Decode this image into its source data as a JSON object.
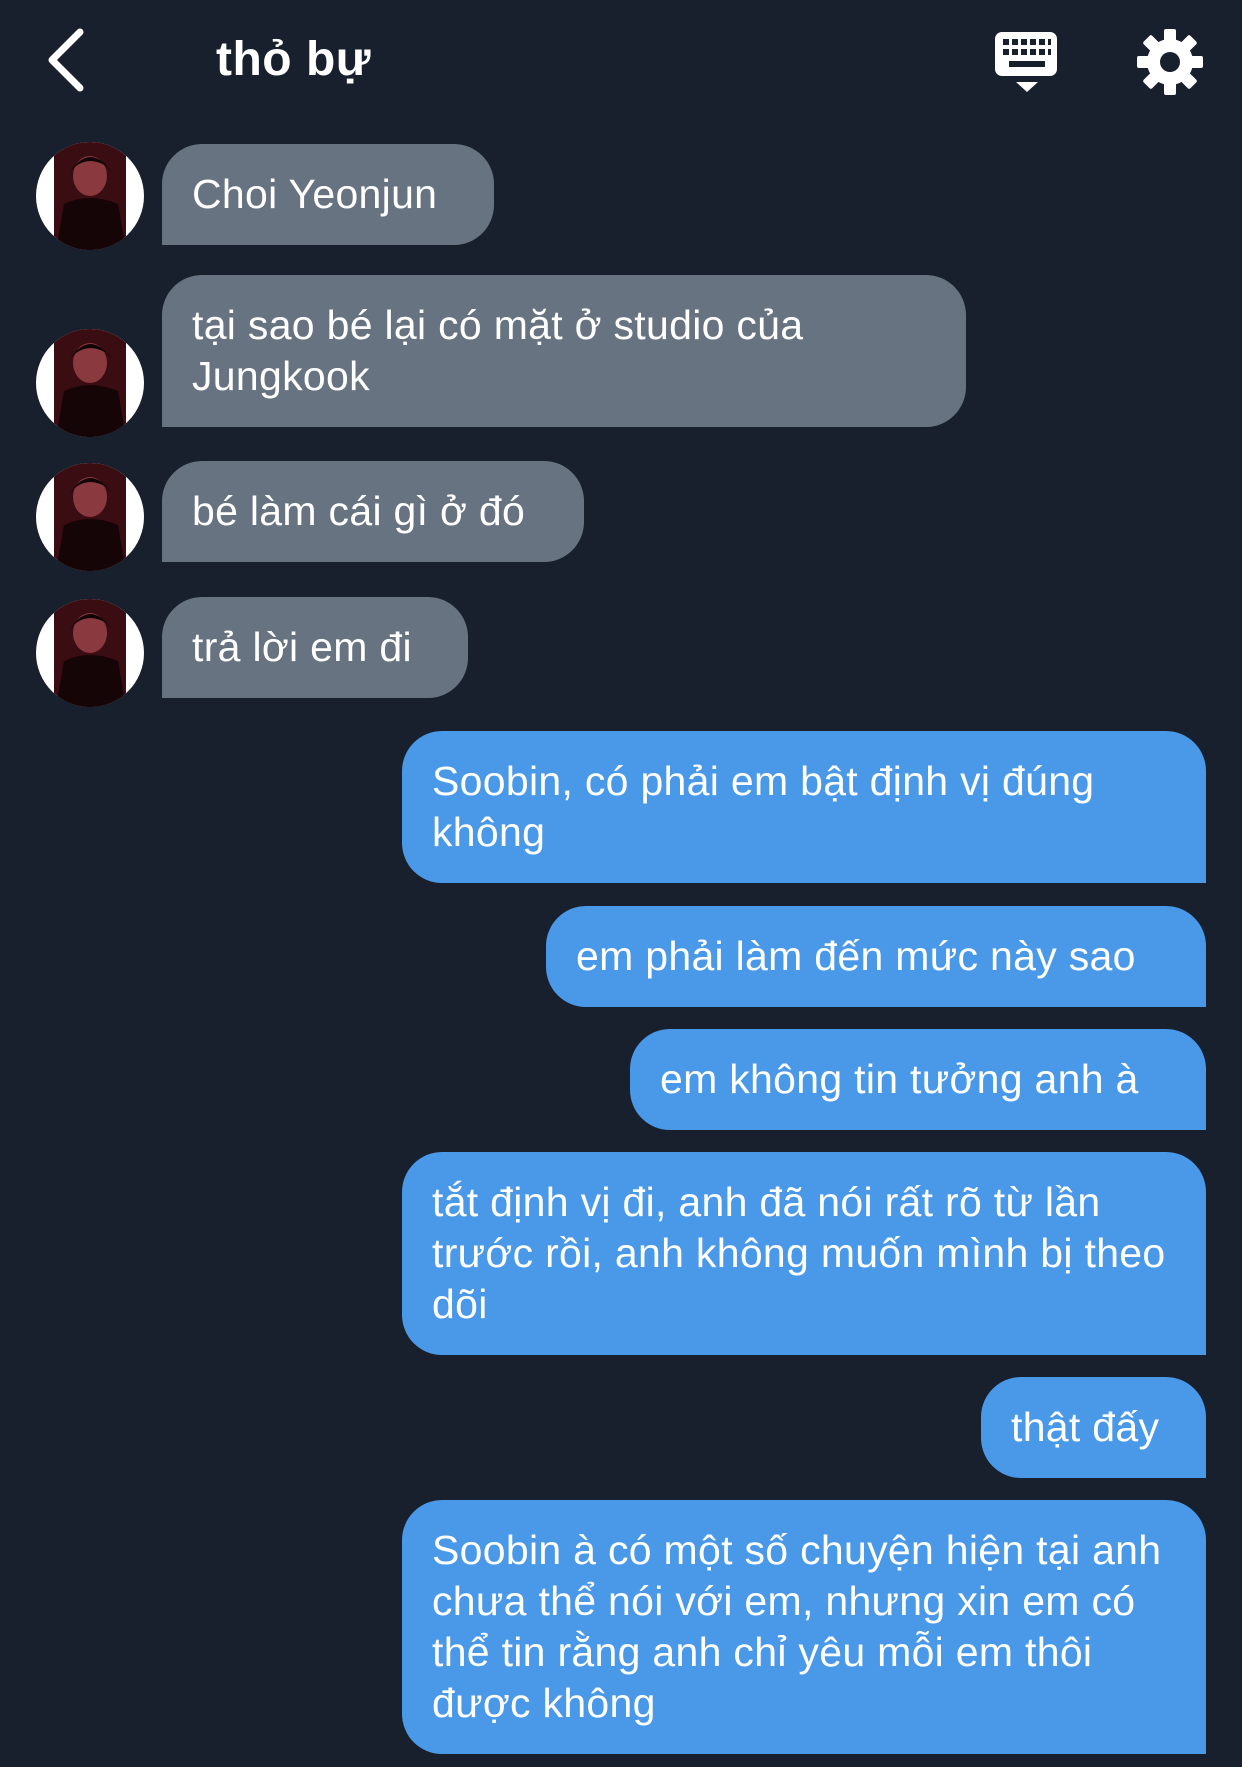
{
  "header": {
    "title": "thỏ bự",
    "back_icon": "chevron-left-icon",
    "keyboard_icon": "keyboard-icon",
    "settings_icon": "gear-icon"
  },
  "colors": {
    "background": "#17202c",
    "incoming_bubble": "#677380",
    "outgoing_bubble": "#4a98e8",
    "text": "#ffffff"
  },
  "messages": [
    {
      "side": "in",
      "text": "Choi Yeonjun"
    },
    {
      "side": "in",
      "text": "tại sao bé lại có mặt ở studio của Jungkook"
    },
    {
      "side": "in",
      "text": "bé làm cái gì ở đó"
    },
    {
      "side": "in",
      "text": "trả lời em đi"
    },
    {
      "side": "out",
      "text": "Soobin, có phải em bật định vị đúng không"
    },
    {
      "side": "out",
      "text": "em phải làm đến mức này sao"
    },
    {
      "side": "out",
      "text": "em không tin tưởng anh à"
    },
    {
      "side": "out",
      "text": "tắt định vị đi, anh đã nói rất rõ từ lần trước rồi, anh không muốn mình bị theo dõi"
    },
    {
      "side": "out",
      "text": "thật đấy"
    },
    {
      "side": "out",
      "text": "Soobin à có một số chuyện hiện tại anh chưa thể nói với em, nhưng xin em có thể tin rằng anh chỉ yêu mỗi em thôi được không"
    }
  ]
}
